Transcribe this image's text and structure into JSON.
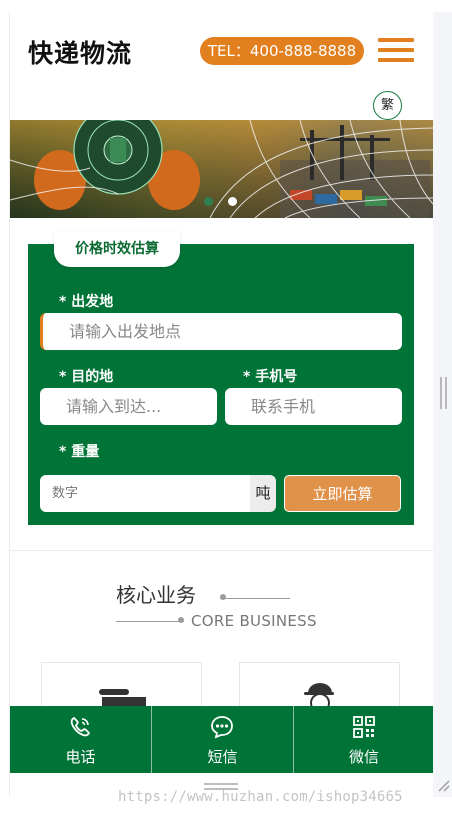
{
  "header": {
    "brand": "快递物流",
    "phone": "TEL：400-888-8888",
    "menu_icon": "hamburger-menu-icon",
    "lang_toggle": "繁"
  },
  "banner": {
    "slide_count": 2,
    "active_slide": 1
  },
  "form": {
    "tab_title": "价格时效估算",
    "origin_label": "* 出发地",
    "origin_placeholder": "请输入出发地点",
    "dest_label": "* 目的地",
    "dest_placeholder": "请输入到达...",
    "phone_label": "* 手机号",
    "phone_placeholder": "联系手机",
    "weight_label": "* 重量",
    "weight_placeholder": "数字",
    "weight_unit": "吨",
    "submit_label": "立即估算"
  },
  "core": {
    "title": "核心业务",
    "subtitle": "CORE BUSINESS"
  },
  "bottom_nav": {
    "items": [
      {
        "label": "电话",
        "icon": "phone-icon"
      },
      {
        "label": "短信",
        "icon": "chat-bubble-icon"
      },
      {
        "label": "微信",
        "icon": "qr-code-icon"
      }
    ]
  },
  "watermark": "https://www.huzhan.com/ishop34665",
  "colors": {
    "brand_green": "#007337",
    "accent_orange": "#e2801f",
    "button_orange": "#e0914a"
  }
}
